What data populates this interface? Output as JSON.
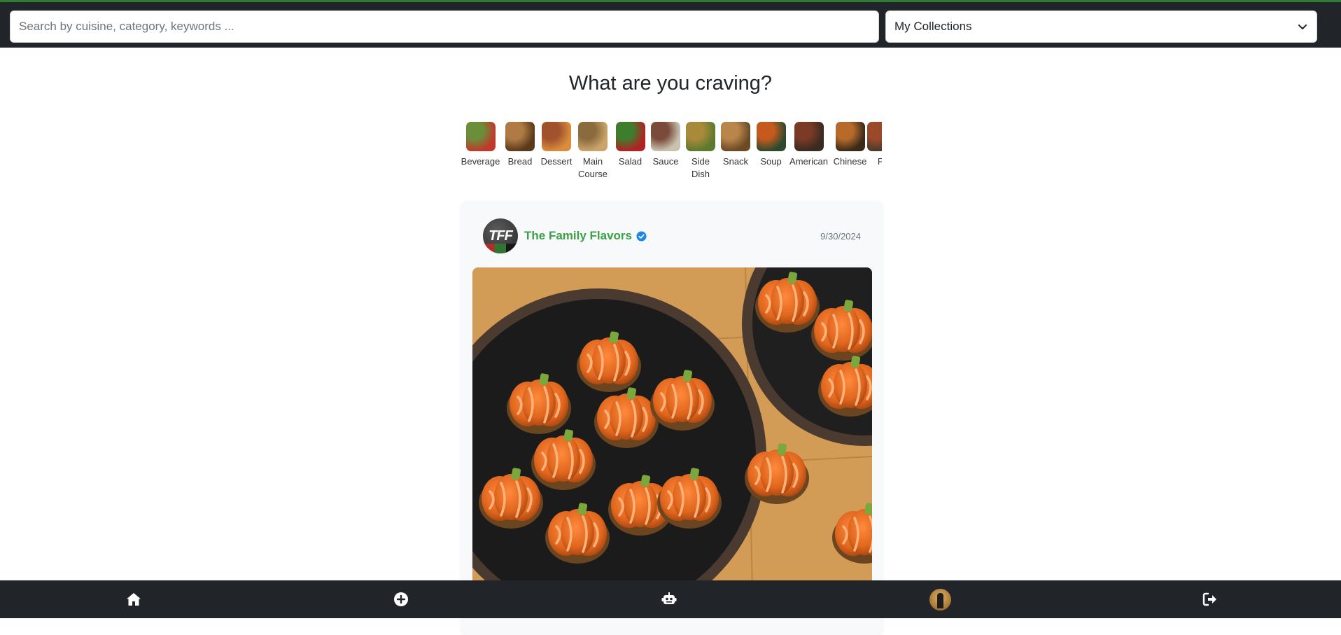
{
  "search": {
    "placeholder": "Search by cuisine, category, keywords ..."
  },
  "collections": {
    "selected": "My Collections"
  },
  "heading": "What are you craving?",
  "categories": [
    {
      "label": "Beverage",
      "colors": [
        "#6b8e3a",
        "#c0392b"
      ]
    },
    {
      "label": "Bread",
      "colors": [
        "#b07a44",
        "#5a3a1a"
      ]
    },
    {
      "label": "Dessert",
      "colors": [
        "#a0522d",
        "#d98c3c"
      ]
    },
    {
      "label": "Main Course",
      "colors": [
        "#8b6a3e",
        "#caa46a"
      ]
    },
    {
      "label": "Salad",
      "colors": [
        "#3e7d2e",
        "#b22222"
      ]
    },
    {
      "label": "Sauce",
      "colors": [
        "#7a4a3a",
        "#c9c2b0"
      ]
    },
    {
      "label": "Side Dish",
      "colors": [
        "#a88a3a",
        "#5d7a2e"
      ]
    },
    {
      "label": "Snack",
      "colors": [
        "#b8864a",
        "#6b4a25"
      ]
    },
    {
      "label": "Soup",
      "colors": [
        "#c65a1e",
        "#2e4a2e"
      ]
    },
    {
      "label": "American",
      "colors": [
        "#7a3a25",
        "#3a2a20"
      ]
    },
    {
      "label": "Chinese",
      "colors": [
        "#b86a2a",
        "#3a2a1a"
      ]
    },
    {
      "label": "Fr",
      "colors": [
        "#9a4a2a",
        "#4a3a2a"
      ]
    }
  ],
  "post": {
    "author_initials": "TFF",
    "author_name": "The Family Flavors",
    "date": "9/30/2024"
  },
  "nav": {
    "home_icon": "home-icon",
    "add_icon": "plus-circle-icon",
    "bot_icon": "robot-icon",
    "profile_icon": "profile-avatar",
    "logout_icon": "logout-icon"
  },
  "colors": {
    "dark_bar": "#212529",
    "accent_green": "#3aa245",
    "verified_blue": "#1e88e5"
  }
}
